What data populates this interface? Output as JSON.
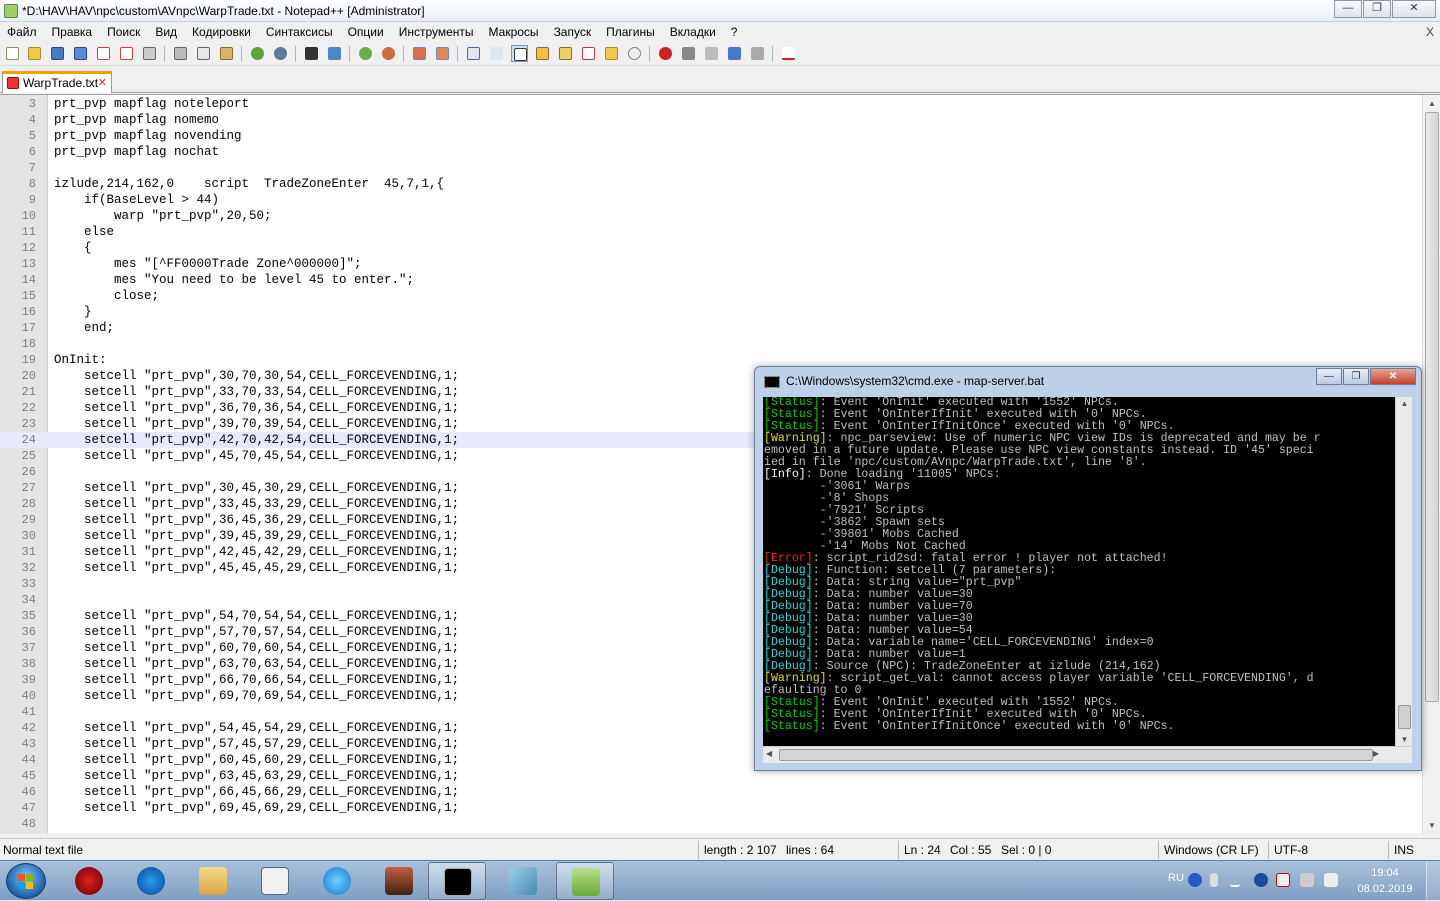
{
  "window": {
    "title": "*D:\\HAV\\HAV\\npc\\custom\\AVnpc\\WarpTrade.txt - Notepad++ [Administrator]",
    "min_symbol": "—",
    "max_symbol": "❐",
    "close_symbol": "✕"
  },
  "menu": {
    "items": [
      "Файл",
      "Правка",
      "Поиск",
      "Вид",
      "Кодировки",
      "Синтаксисы",
      "Опции",
      "Инструменты",
      "Макросы",
      "Запуск",
      "Плагины",
      "Вкладки",
      "?"
    ],
    "close_symbol": "X"
  },
  "tab": {
    "label": "WarpTrade.txt",
    "close_symbol": "✕"
  },
  "editor": {
    "current_line": 24,
    "lines": [
      {
        "n": "3",
        "text": "prt_pvp mapflag noteleport"
      },
      {
        "n": "4",
        "text": "prt_pvp mapflag nomemo"
      },
      {
        "n": "5",
        "text": "prt_pvp mapflag novending"
      },
      {
        "n": "6",
        "text": "prt_pvp mapflag nochat"
      },
      {
        "n": "7",
        "text": ""
      },
      {
        "n": "8",
        "text": "izlude,214,162,0    script  TradeZoneEnter  45,7,1,{"
      },
      {
        "n": "9",
        "text": "    if(BaseLevel > 44)"
      },
      {
        "n": "10",
        "text": "        warp \"prt_pvp\",20,50;"
      },
      {
        "n": "11",
        "text": "    else"
      },
      {
        "n": "12",
        "text": "    {"
      },
      {
        "n": "13",
        "text": "        mes \"[^FF0000Trade Zone^000000]\";"
      },
      {
        "n": "14",
        "text": "        mes \"You need to be level 45 to enter.\";"
      },
      {
        "n": "15",
        "text": "        close;"
      },
      {
        "n": "16",
        "text": "    }"
      },
      {
        "n": "17",
        "text": "    end;"
      },
      {
        "n": "18",
        "text": ""
      },
      {
        "n": "19",
        "text": "OnInit:"
      },
      {
        "n": "20",
        "text": "    setcell \"prt_pvp\",30,70,30,54,CELL_FORCEVENDING,1;"
      },
      {
        "n": "21",
        "text": "    setcell \"prt_pvp\",33,70,33,54,CELL_FORCEVENDING,1;"
      },
      {
        "n": "22",
        "text": "    setcell \"prt_pvp\",36,70,36,54,CELL_FORCEVENDING,1;"
      },
      {
        "n": "23",
        "text": "    setcell \"prt_pvp\",39,70,39,54,CELL_FORCEVENDING,1;"
      },
      {
        "n": "24",
        "text": "    setcell \"prt_pvp\",42,70,42,54,CELL_FORCEVENDING,1;"
      },
      {
        "n": "25",
        "text": "    setcell \"prt_pvp\",45,70,45,54,CELL_FORCEVENDING,1;"
      },
      {
        "n": "26",
        "text": ""
      },
      {
        "n": "27",
        "text": "    setcell \"prt_pvp\",30,45,30,29,CELL_FORCEVENDING,1;"
      },
      {
        "n": "28",
        "text": "    setcell \"prt_pvp\",33,45,33,29,CELL_FORCEVENDING,1;"
      },
      {
        "n": "29",
        "text": "    setcell \"prt_pvp\",36,45,36,29,CELL_FORCEVENDING,1;"
      },
      {
        "n": "30",
        "text": "    setcell \"prt_pvp\",39,45,39,29,CELL_FORCEVENDING,1;"
      },
      {
        "n": "31",
        "text": "    setcell \"prt_pvp\",42,45,42,29,CELL_FORCEVENDING,1;"
      },
      {
        "n": "32",
        "text": "    setcell \"prt_pvp\",45,45,45,29,CELL_FORCEVENDING,1;"
      },
      {
        "n": "33",
        "text": ""
      },
      {
        "n": "34",
        "text": ""
      },
      {
        "n": "35",
        "text": "    setcell \"prt_pvp\",54,70,54,54,CELL_FORCEVENDING,1;"
      },
      {
        "n": "36",
        "text": "    setcell \"prt_pvp\",57,70,57,54,CELL_FORCEVENDING,1;"
      },
      {
        "n": "37",
        "text": "    setcell \"prt_pvp\",60,70,60,54,CELL_FORCEVENDING,1;"
      },
      {
        "n": "38",
        "text": "    setcell \"prt_pvp\",63,70,63,54,CELL_FORCEVENDING,1;"
      },
      {
        "n": "39",
        "text": "    setcell \"prt_pvp\",66,70,66,54,CELL_FORCEVENDING,1;"
      },
      {
        "n": "40",
        "text": "    setcell \"prt_pvp\",69,70,69,54,CELL_FORCEVENDING,1;"
      },
      {
        "n": "41",
        "text": ""
      },
      {
        "n": "42",
        "text": "    setcell \"prt_pvp\",54,45,54,29,CELL_FORCEVENDING,1;"
      },
      {
        "n": "43",
        "text": "    setcell \"prt_pvp\",57,45,57,29,CELL_FORCEVENDING,1;"
      },
      {
        "n": "44",
        "text": "    setcell \"prt_pvp\",60,45,60,29,CELL_FORCEVENDING,1;"
      },
      {
        "n": "45",
        "text": "    setcell \"prt_pvp\",63,45,63,29,CELL_FORCEVENDING,1;"
      },
      {
        "n": "46",
        "text": "    setcell \"prt_pvp\",66,45,66,29,CELL_FORCEVENDING,1;"
      },
      {
        "n": "47",
        "text": "    setcell \"prt_pvp\",69,45,69,29,CELL_FORCEVENDING,1;"
      },
      {
        "n": "48",
        "text": ""
      }
    ]
  },
  "statusbar": {
    "type": "Normal text file",
    "length": "length : 2 107",
    "lines": "lines : 64",
    "position": "Ln : 24",
    "col": "Col : 55",
    "sel": "Sel : 0 | 0",
    "eol": "Windows (CR LF)",
    "encoding": "UTF-8",
    "mode": "INS"
  },
  "cmd": {
    "title": "C:\\Windows\\system32\\cmd.exe - map-server.bat",
    "lines": [
      {
        "tag": "[Status]",
        "kind": "status",
        "text": ": Event 'OnInit' executed with '1552' NPCs."
      },
      {
        "tag": "[Status]",
        "kind": "status",
        "text": ": Event 'OnInterIfInit' executed with '0' NPCs."
      },
      {
        "tag": "[Status]",
        "kind": "status",
        "text": ": Event 'OnInterIfInitOnce' executed with '0' NPCs."
      },
      {
        "tag": "[Warning]",
        "kind": "warning",
        "text": ": npc_parseview: Use of numeric NPC view IDs is deprecated and may be r"
      },
      {
        "tag": "",
        "kind": "plain",
        "text": "emoved in a future update. Please use NPC view constants instead. ID '45' speci"
      },
      {
        "tag": "",
        "kind": "plain",
        "text": "ied in file 'npc/custom/AVnpc/WarpTrade.txt', line '8'."
      },
      {
        "tag": "[Info]",
        "kind": "info",
        "text": ": Done loading '11005' NPCs:"
      },
      {
        "tag": "",
        "kind": "plain",
        "text": "        -'3061' Warps"
      },
      {
        "tag": "",
        "kind": "plain",
        "text": "        -'8' Shops"
      },
      {
        "tag": "",
        "kind": "plain",
        "text": "        -'7921' Scripts"
      },
      {
        "tag": "",
        "kind": "plain",
        "text": "        -'3862' Spawn sets"
      },
      {
        "tag": "",
        "kind": "plain",
        "text": "        -'39801' Mobs Cached"
      },
      {
        "tag": "",
        "kind": "plain",
        "text": "        -'14' Mobs Not Cached"
      },
      {
        "tag": "[Error]",
        "kind": "error",
        "text": ": script_rid2sd: fatal error ! player not attached!"
      },
      {
        "tag": "[Debug]",
        "kind": "debug",
        "text": ": Function: setcell (7 parameters):"
      },
      {
        "tag": "[Debug]",
        "kind": "debug",
        "text": ": Data: string value=\"prt_pvp\""
      },
      {
        "tag": "[Debug]",
        "kind": "debug",
        "text": ": Data: number value=30"
      },
      {
        "tag": "[Debug]",
        "kind": "debug",
        "text": ": Data: number value=70"
      },
      {
        "tag": "[Debug]",
        "kind": "debug",
        "text": ": Data: number value=30"
      },
      {
        "tag": "[Debug]",
        "kind": "debug",
        "text": ": Data: number value=54"
      },
      {
        "tag": "[Debug]",
        "kind": "debug",
        "text": ": Data: variable name='CELL_FORCEVENDING' index=0"
      },
      {
        "tag": "[Debug]",
        "kind": "debug",
        "text": ": Data: number value=1"
      },
      {
        "tag": "[Debug]",
        "kind": "debug",
        "text": ": Source (NPC): TradeZoneEnter at izlude (214,162)"
      },
      {
        "tag": "[Warning]",
        "kind": "warning",
        "text": ": script_get_val: cannot access player variable 'CELL_FORCEVENDING', d"
      },
      {
        "tag": "",
        "kind": "plain",
        "text": "efaulting to 0"
      },
      {
        "tag": "[Status]",
        "kind": "status",
        "text": ": Event 'OnInit' executed with '1552' NPCs."
      },
      {
        "tag": "[Status]",
        "kind": "status",
        "text": ": Event 'OnInterIfInit' executed with '0' NPCs."
      },
      {
        "tag": "[Status]",
        "kind": "status",
        "text": ": Event 'OnInterIfInitOnce' executed with '0' NPCs."
      }
    ]
  },
  "taskbar": {
    "lang": "RU",
    "time": "19:04",
    "date": "08.02.2019"
  },
  "colors": {
    "status": "#00d000",
    "warning": "#e0e000",
    "info": "#ffffff",
    "error": "#ff2020",
    "debug": "#20d8e0"
  }
}
